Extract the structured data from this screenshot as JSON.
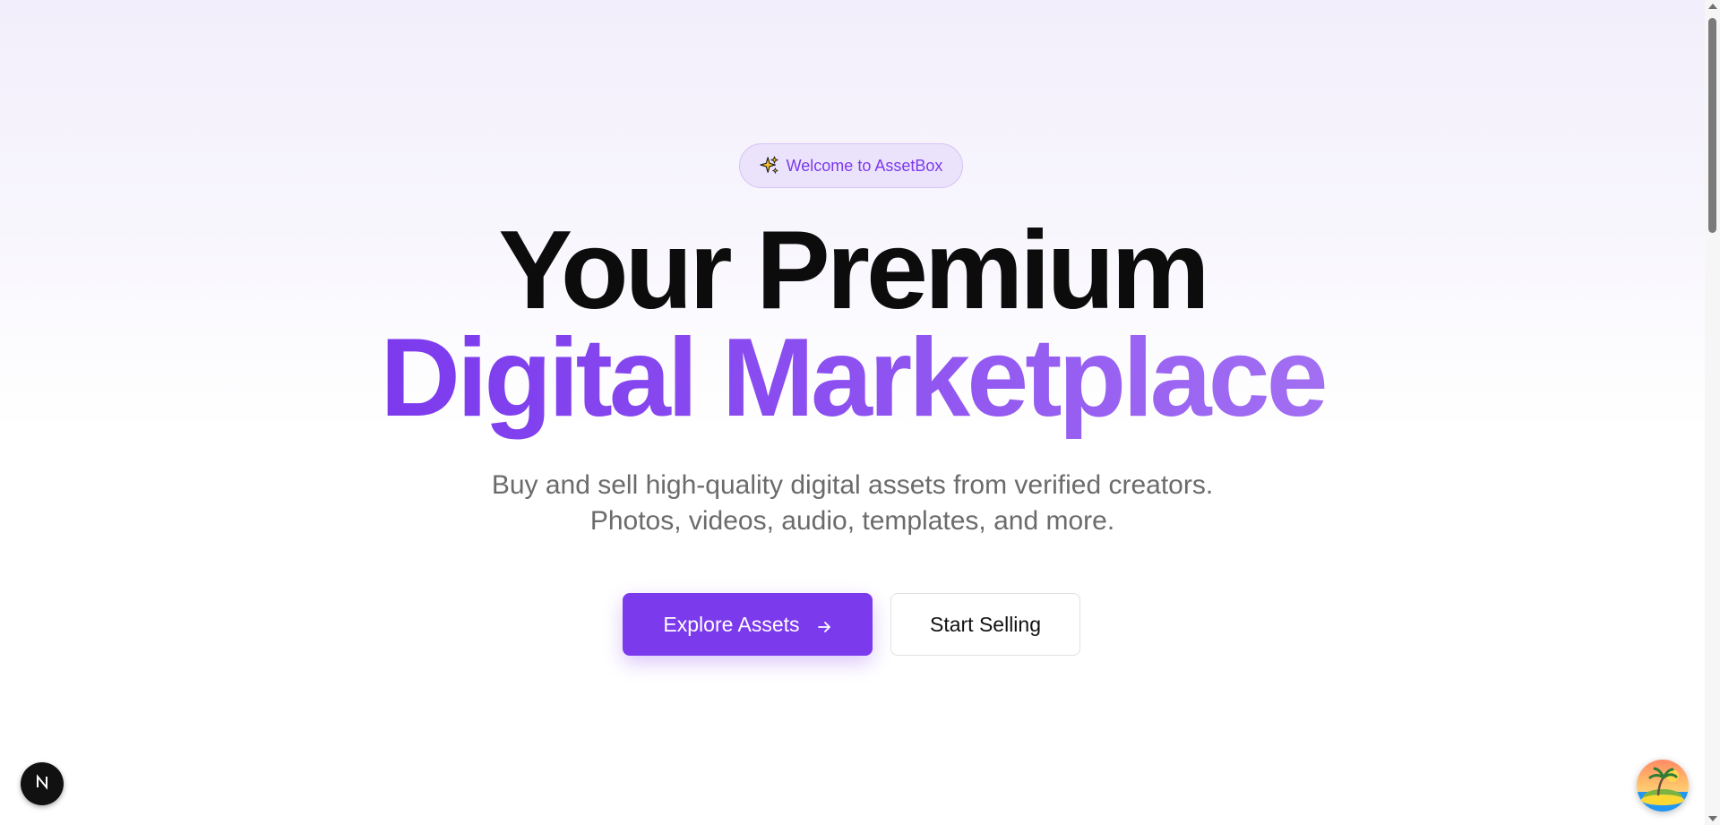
{
  "hero": {
    "badge_text": "Welcome to AssetBox",
    "badge_icon": "sparkles-icon",
    "title_line1": "Your Premium",
    "title_line2": "Digital Marketplace",
    "subtitle_line1": "Buy and sell high-quality digital assets from verified creators.",
    "subtitle_line2": "Photos, videos, audio, templates, and more.",
    "primary_button": "Explore Assets",
    "primary_button_icon": "arrow-right-icon",
    "secondary_button": "Start Selling"
  },
  "colors": {
    "accent": "#7c3aed",
    "title": "#0c0c0c",
    "subtitle": "#6b6b6b",
    "badge_bg": "#ebe2fb"
  },
  "overlays": {
    "dev_badge_icon": "nextjs-n-icon",
    "avatar_icon": "island-avatar-icon"
  }
}
